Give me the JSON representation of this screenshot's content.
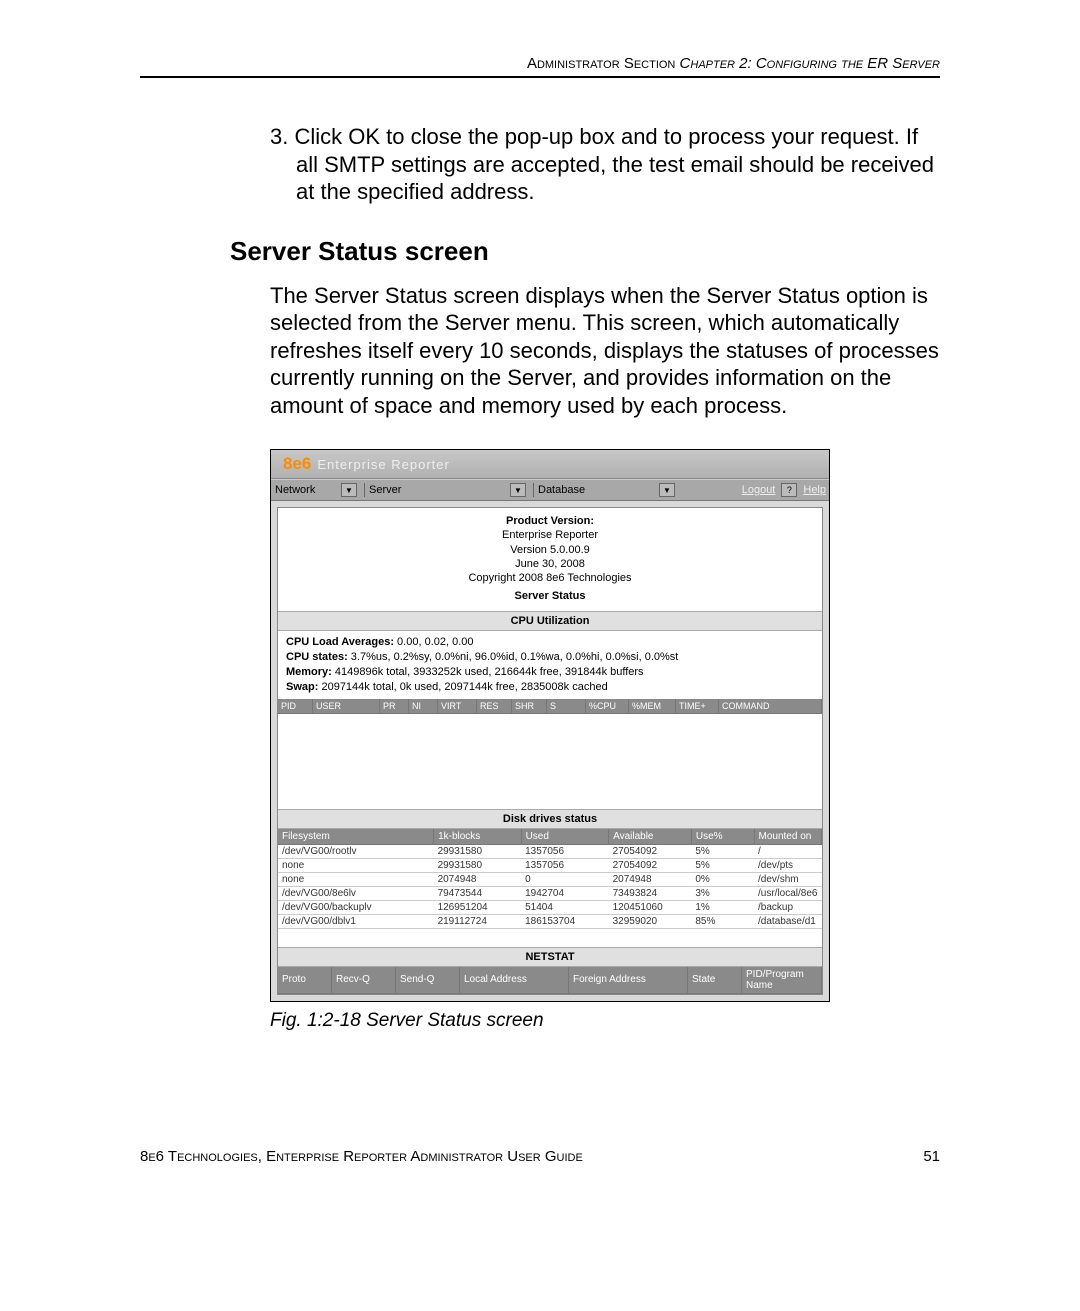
{
  "header": {
    "section": "Administrator Section",
    "chapter": "Chapter 2: Configuring the ER Server"
  },
  "step3": "3.  Click OK to close the pop-up box and to process your request. If all SMTP settings are accepted, the test email should be received at the specified address.",
  "heading": "Server Status screen",
  "intro": "The Server Status screen displays when the Server Status option is selected from the Server menu. This screen, which automatically refreshes itself every 10 seconds, displays the statuses of processes currently running on the Server, and provides information on the amount of space and memory used by each process.",
  "screenshot": {
    "brand1": "8e6",
    "brand2": "Enterprise Reporter",
    "menus": {
      "network": "Network",
      "server": "Server",
      "database": "Database"
    },
    "links": {
      "logout": "Logout",
      "help": "Help"
    },
    "product": {
      "title": "Product Version:",
      "name": "Enterprise Reporter",
      "version": "Version 5.0.00.9",
      "date": "June 30, 2008",
      "copyright": "Copyright 2008 8e6 Technologies"
    },
    "server_status_label": "Server Status",
    "cpu_util_label": "CPU Utilization",
    "cpu_lines": {
      "load_label": "CPU Load Averages:",
      "load_val": " 0.00, 0.02, 0.00",
      "states_label": "CPU states:",
      "states_val": " 3.7%us, 0.2%sy, 0.0%ni, 96.0%id, 0.1%wa, 0.0%hi, 0.0%si, 0.0%st",
      "mem_label": "Memory:",
      "mem_val": " 4149896k total, 3933252k used, 216644k free, 391844k buffers",
      "swap_label": "Swap:",
      "swap_val": " 2097144k total, 0k used, 2097144k free, 2835008k cached"
    },
    "top_headers": [
      "PID",
      "USER",
      "PR",
      "NI",
      "VIRT",
      "RES",
      "SHR",
      "S",
      "%CPU",
      "%MEM",
      "TIME+",
      "COMMAND"
    ],
    "disk_drives_label": "Disk drives status",
    "disk_headers": [
      "Filesystem",
      "1k-blocks",
      "Used",
      "Available",
      "Use%",
      "Mounted on"
    ],
    "disk_rows": [
      [
        "/dev/VG00/rootlv",
        "29931580",
        "1357056",
        "27054092",
        "5%",
        "/"
      ],
      [
        "none",
        "29931580",
        "1357056",
        "27054092",
        "5%",
        "/dev/pts"
      ],
      [
        "none",
        "2074948",
        "0",
        "2074948",
        "0%",
        "/dev/shm"
      ],
      [
        "/dev/VG00/8e6lv",
        "79473544",
        "1942704",
        "73493824",
        "3%",
        "/usr/local/8e6"
      ],
      [
        "/dev/VG00/backuplv",
        "126951204",
        "51404",
        "120451060",
        "1%",
        "/backup"
      ],
      [
        "/dev/VG00/dblv1",
        "219112724",
        "186153704",
        "32959020",
        "85%",
        "/database/d1"
      ]
    ],
    "netstat_label": "NETSTAT",
    "netstat_headers": [
      "Proto",
      "Recv-Q",
      "Send-Q",
      "Local Address",
      "Foreign Address",
      "State",
      "PID/Program Name"
    ]
  },
  "caption": "Fig. 1:2-18  Server Status screen",
  "footer": {
    "left": "8e6 Technologies, Enterprise Reporter Administrator User Guide",
    "right": "51"
  }
}
